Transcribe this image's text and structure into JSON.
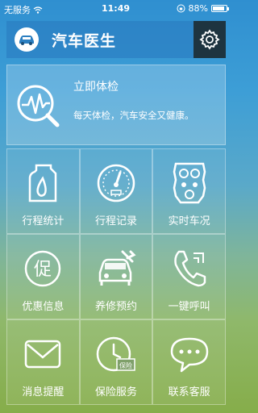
{
  "status_bar": {
    "carrier": "无服务",
    "time": "11:49",
    "battery_text": "88%",
    "battery_level": 0.88
  },
  "header": {
    "title": "汽车医生",
    "logo_icon": "car-logo-icon",
    "settings_icon": "gear-icon"
  },
  "checkup": {
    "title": "立即体检",
    "description": "每天体检，汽车安全又健康。",
    "icon": "heartbeat-magnifier-icon"
  },
  "grid": [
    {
      "label": "行程统计",
      "icon": "fuel-can-icon"
    },
    {
      "label": "行程记录",
      "icon": "speedometer-icon"
    },
    {
      "label": "实时车况",
      "icon": "engine-block-icon"
    },
    {
      "label": "优惠信息",
      "icon": "discount-badge-icon"
    },
    {
      "label": "养修预约",
      "icon": "car-wrench-icon"
    },
    {
      "label": "一键呼叫",
      "icon": "phone-icon"
    },
    {
      "label": "消息提醒",
      "icon": "envelope-icon"
    },
    {
      "label": "保险服务",
      "icon": "insurance-clock-icon"
    },
    {
      "label": "联系客服",
      "icon": "chat-bubble-icon"
    }
  ]
}
